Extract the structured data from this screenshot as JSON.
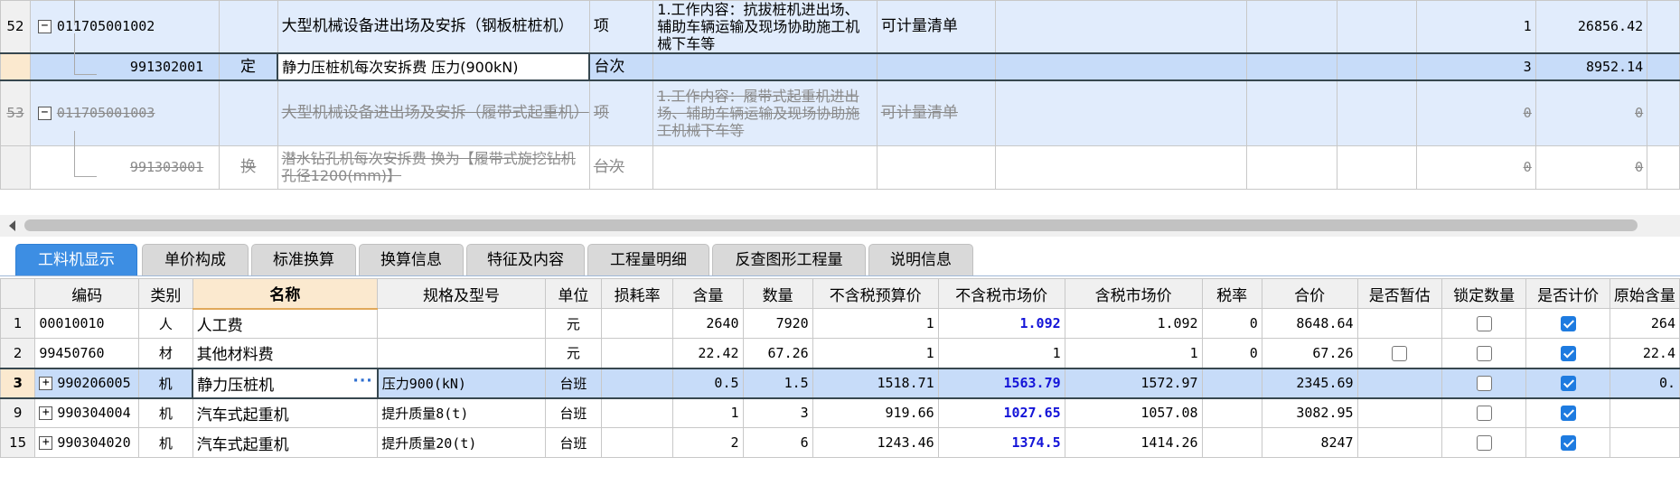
{
  "upper_rows": [
    {
      "num": "52",
      "code": "011705001002",
      "kind": "",
      "name": "大型机械设备进出场及安拆（钢板桩桩机）",
      "unit": "项",
      "feature": "1.工作内容：抗拔桩机进出场、辅助车辆运输及现场协助施工机械下车等",
      "calc": "可计量清单",
      "qty": "1",
      "price": "26856.42",
      "strike": false
    },
    {
      "num": "",
      "code": "991302001",
      "kind": "定",
      "name": "静力压桩机每次安拆费 压力(900kN)",
      "unit": "台次",
      "feature": "",
      "calc": "",
      "qty": "3",
      "price": "8952.14",
      "strike": false
    },
    {
      "num": "53",
      "code": "011705001003",
      "kind": "",
      "name": "大型机械设备进出场及安拆（履带式起重机）",
      "unit": "项",
      "feature": "1.工作内容：履带式起重机进出场、辅助车辆运输及现场协助施工机械下车等",
      "calc": "可计量清单",
      "qty": "0",
      "price": "0",
      "strike": true
    },
    {
      "num": "",
      "code": "991303001",
      "kind": "换",
      "name": "潜水钻孔机每次安拆费 换为【履带式旋挖钻机孔径1200(mm)】",
      "unit": "台次",
      "feature": "",
      "calc": "",
      "qty": "0",
      "price": "0",
      "strike": true
    }
  ],
  "tabs": [
    "工料机显示",
    "单价构成",
    "标准换算",
    "换算信息",
    "特征及内容",
    "工程量明细",
    "反查图形工程量",
    "说明信息"
  ],
  "headers": [
    "",
    "编码",
    "类别",
    "名称",
    "规格及型号",
    "单位",
    "损耗率",
    "含量",
    "数量",
    "不含税预算价",
    "不含税市场价",
    "含税市场价",
    "税率",
    "合价",
    "是否暂估",
    "锁定数量",
    "是否计价",
    "原始含量"
  ],
  "rows": [
    {
      "rn": "1",
      "code": "00010010",
      "cat": "人",
      "name": "人工费",
      "spec": "",
      "unit": "元",
      "loss": "",
      "content": "2640",
      "qty": "7920",
      "budget": "1",
      "market": "1.092",
      "tax_market": "1.092",
      "rate": "0",
      "total": "8648.64",
      "est": "",
      "lock": "box",
      "priced": "on",
      "orig": "264"
    },
    {
      "rn": "2",
      "code": "99450760",
      "cat": "材",
      "name": "其他材料费",
      "spec": "",
      "unit": "元",
      "loss": "",
      "content": "22.42",
      "qty": "67.26",
      "budget": "1",
      "market": "1",
      "tax_market": "1",
      "rate": "0",
      "total": "67.26",
      "est": "box",
      "lock": "box",
      "priced": "on",
      "orig": "22.4"
    },
    {
      "rn": "3",
      "code": "990206005",
      "cat": "机",
      "name": "静力压桩机",
      "spec": "压力900(kN)",
      "unit": "台班",
      "loss": "",
      "content": "0.5",
      "qty": "1.5",
      "budget": "1518.71",
      "market": "1563.79",
      "tax_market": "1572.97",
      "rate": "",
      "total": "2345.69",
      "est": "",
      "lock": "box",
      "priced": "on",
      "orig": "0."
    },
    {
      "rn": "9",
      "code": "990304004",
      "cat": "机",
      "name": "汽车式起重机",
      "spec": "提升质量8(t)",
      "unit": "台班",
      "loss": "",
      "content": "1",
      "qty": "3",
      "budget": "919.66",
      "market": "1027.65",
      "tax_market": "1057.08",
      "rate": "",
      "total": "3082.95",
      "est": "",
      "lock": "box",
      "priced": "on",
      "orig": ""
    },
    {
      "rn": "15",
      "code": "990304020",
      "cat": "机",
      "name": "汽车式起重机",
      "spec": "提升质量20(t)",
      "unit": "台班",
      "loss": "",
      "content": "2",
      "qty": "6",
      "budget": "1243.46",
      "market": "1374.5",
      "tax_market": "1414.26",
      "rate": "",
      "total": "8247",
      "est": "",
      "lock": "box",
      "priced": "on",
      "orig": ""
    }
  ],
  "icons": {
    "expand": "minus-box-icon",
    "collapse": "plus-box-icon",
    "more": "ellipsis-icon",
    "check": "checkbox-icon"
  }
}
